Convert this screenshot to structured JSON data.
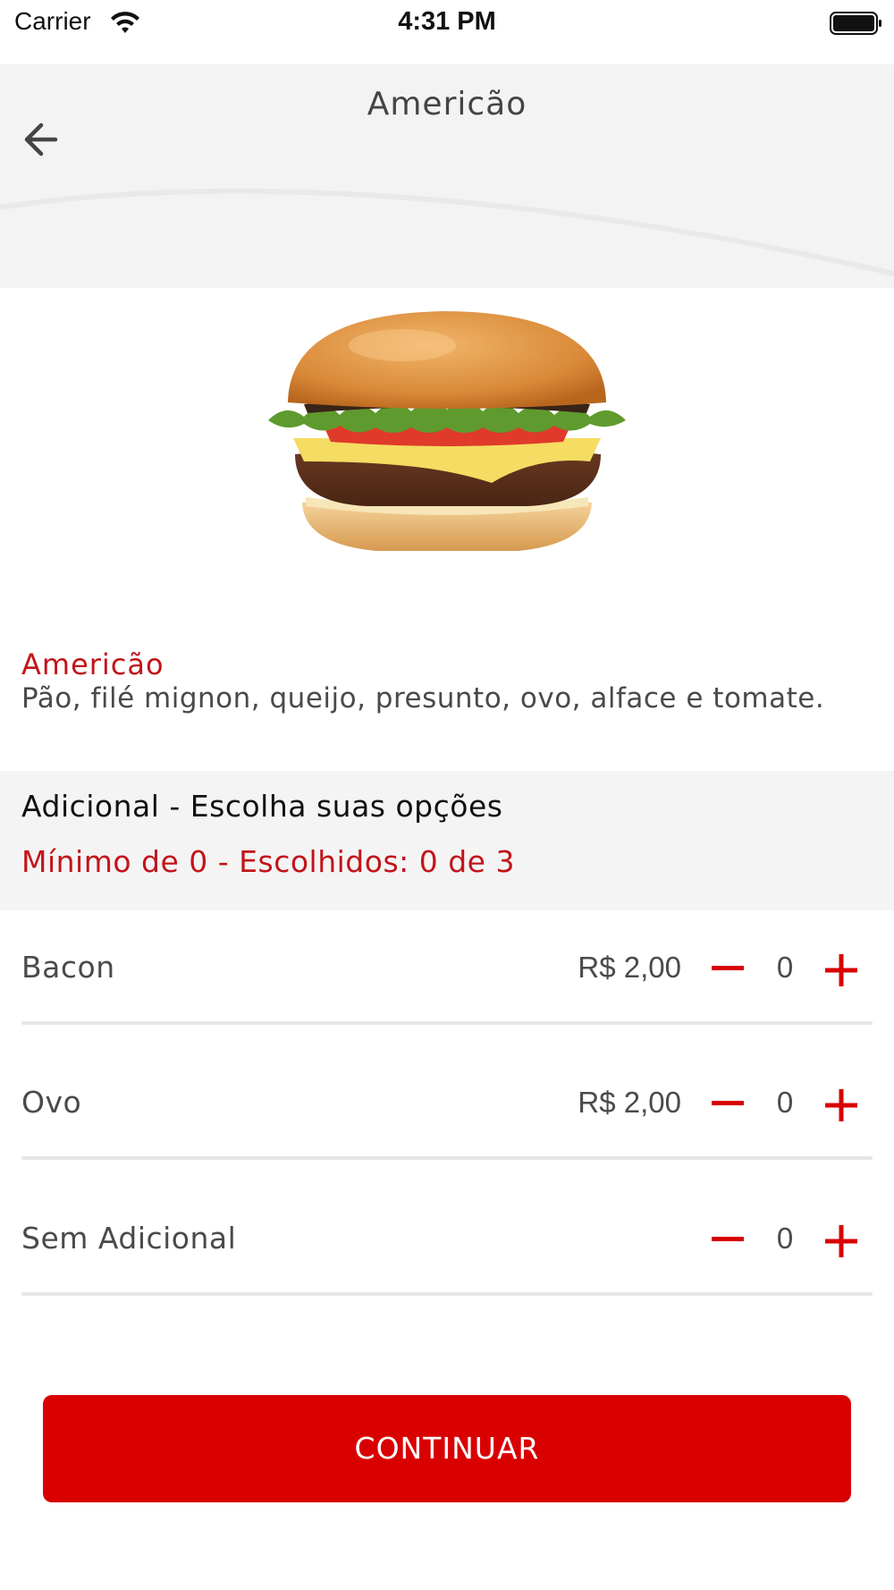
{
  "status_bar": {
    "carrier": "Carrier",
    "time": "4:31 PM",
    "wifi_icon": "wifi-icon",
    "battery_icon": "battery-full-icon"
  },
  "header": {
    "title": "Americão",
    "back_icon": "arrow-left-icon"
  },
  "product": {
    "image_icon": "burger-image",
    "name": "Americão",
    "description": "Pão, filé mignon, queijo, presunto, ovo, alface e tomate."
  },
  "section": {
    "title": "Adicional - Escolha suas opções",
    "subtitle": "Mínimo de 0 - Escolhidos: 0 de 3"
  },
  "options": [
    {
      "name": "Bacon",
      "price": "R$ 2,00",
      "qty": "0"
    },
    {
      "name": "Ovo",
      "price": "R$ 2,00",
      "qty": "0"
    },
    {
      "name": "Sem Adicional",
      "price": "",
      "qty": "0"
    }
  ],
  "continue_label": "CONTINUAR",
  "colors": {
    "accent": "#d90000",
    "accent_text": "#c2141a",
    "header_bg": "#f3f3f3",
    "section_bg": "#f4f4f4"
  }
}
